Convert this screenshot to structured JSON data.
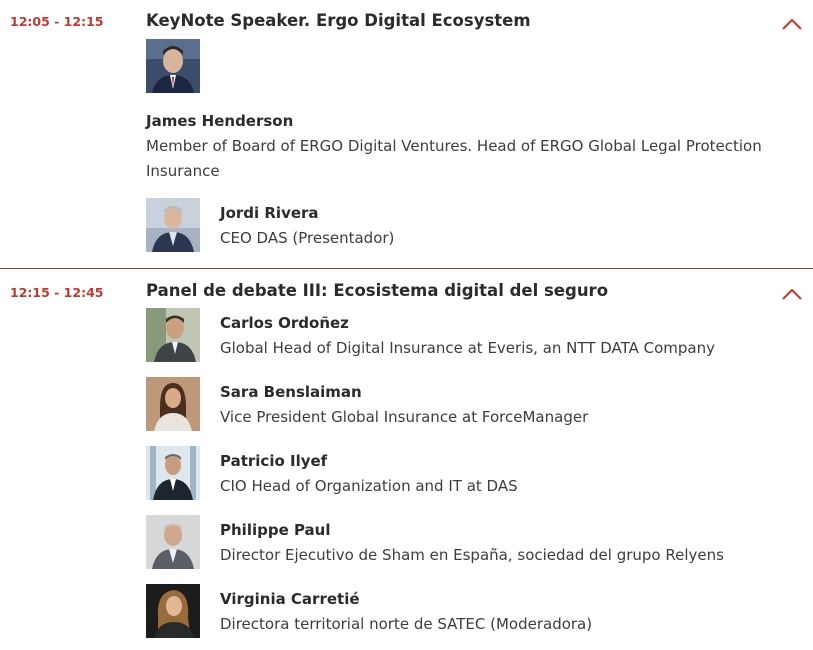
{
  "colors": {
    "accent": "#c0392b",
    "divider": "#b03a3a"
  },
  "sessions": [
    {
      "time": "12:05 - 12:15",
      "title": "KeyNote Speaker. Ergo Digital Ecosystem",
      "toggle_icon": "chevron-up-icon",
      "featured": {
        "name": "James Henderson",
        "role": "Member of Board of ERGO Digital Ventures. Head of ERGO Global Legal Protection Insurance"
      },
      "speakers": [
        {
          "name": "Jordi Rivera",
          "role": "CEO DAS (Presentador)"
        }
      ]
    },
    {
      "time": "12:15 - 12:45",
      "title": "Panel de debate III: Ecosistema digital del seguro",
      "toggle_icon": "chevron-up-icon",
      "speakers": [
        {
          "name": "Carlos Ordoñez",
          "role": "Global Head of Digital Insurance at Everis, an NTT DATA Company"
        },
        {
          "name": "Sara Benslaiman",
          "role": "Vice President Global Insurance at ForceManager"
        },
        {
          "name": "Patricio Ilyef",
          "role": "CIO Head of Organization and IT at DAS"
        },
        {
          "name": "Philippe Paul",
          "role": "Director Ejecutivo de Sham en España, sociedad del grupo Relyens"
        },
        {
          "name": "Virginia Carretié",
          "role": "Directora territorial norte de SATEC (Moderadora)"
        }
      ]
    }
  ]
}
